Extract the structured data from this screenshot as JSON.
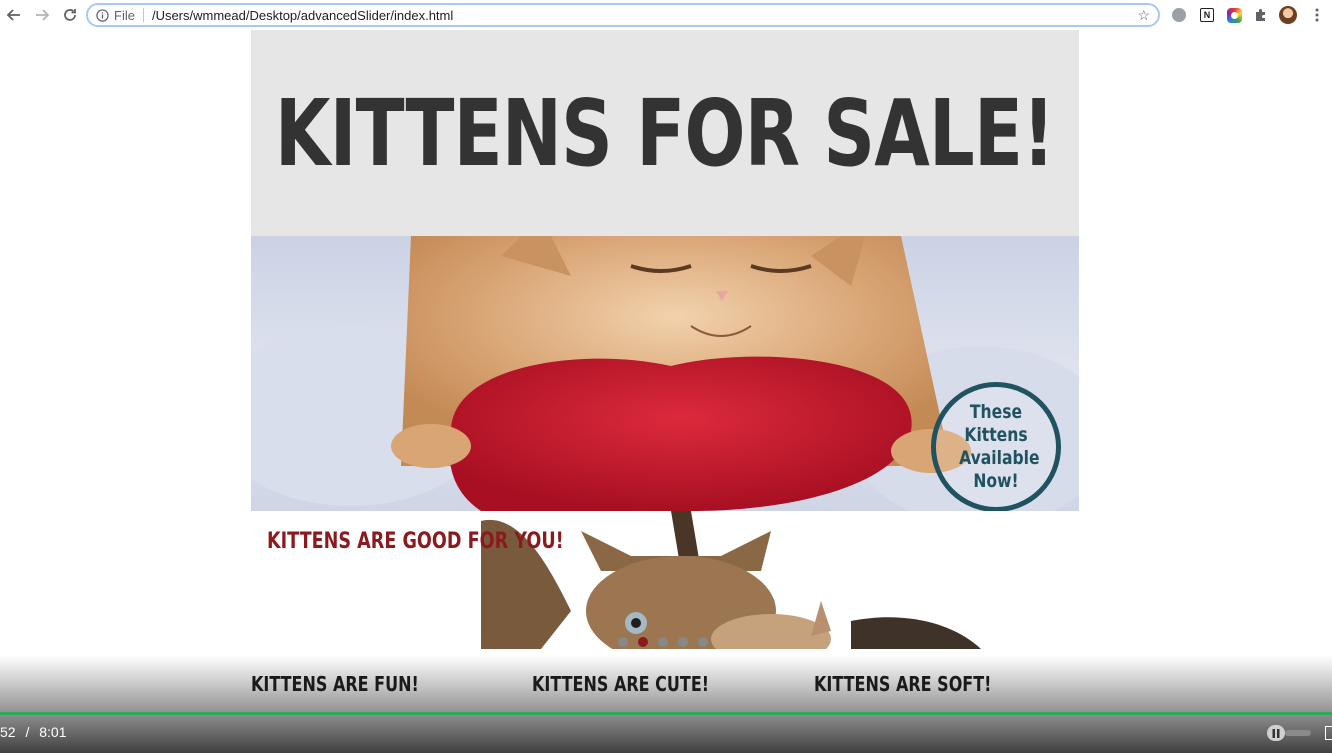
{
  "browser": {
    "file_label": "File",
    "url": "/Users/wmmead/Desktop/advancedSlider/index.html"
  },
  "page": {
    "title": "KITTENS FOR SALE!",
    "badge": "These Kittens Available Now!",
    "slide_heading": "KITTENS ARE GOOD FOR YOU!",
    "dots": {
      "count": 5,
      "active_index": 1
    },
    "columns": [
      {
        "heading": "KITTENS ARE FUN!"
      },
      {
        "heading": "KITTENS ARE CUTE!"
      },
      {
        "heading": "KITTENS ARE SOFT!"
      }
    ]
  },
  "video": {
    "current_time": "52",
    "separator": "/",
    "duration": "8:01"
  },
  "colors": {
    "accent_red": "#8b1a1f",
    "badge_teal": "#215260",
    "progress_green": "#2eaa5c"
  }
}
